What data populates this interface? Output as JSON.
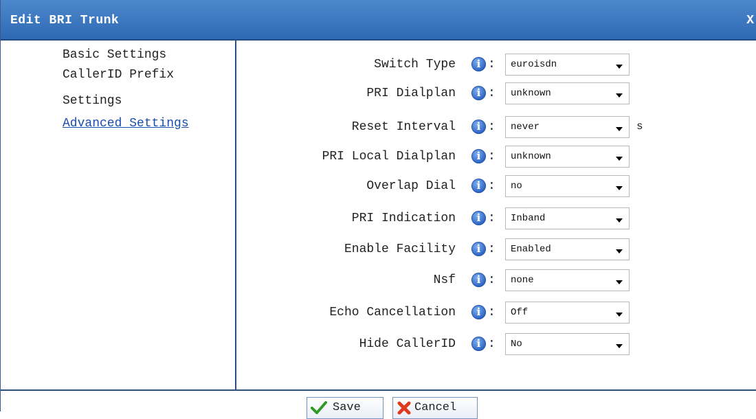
{
  "dialog": {
    "title": "Edit BRI Trunk",
    "close_label": "X"
  },
  "sidebar": {
    "items": [
      {
        "label": "Basic Settings",
        "active": false
      },
      {
        "label": "CallerID Prefix",
        "active": false
      },
      {
        "label": "Settings",
        "active": false
      },
      {
        "label": "Advanced Settings",
        "active": true
      }
    ]
  },
  "form": {
    "switch_type": {
      "label": "Switch Type",
      "value": "euroisdn"
    },
    "pri_dialplan": {
      "label": "PRI Dialplan",
      "value": "unknown"
    },
    "reset_interval": {
      "label": "Reset Interval",
      "value": "never",
      "suffix": "s"
    },
    "pri_local_dialplan": {
      "label": "PRI Local Dialplan",
      "value": "unknown"
    },
    "overlap_dial": {
      "label": "Overlap Dial",
      "value": "no"
    },
    "pri_indication": {
      "label": "PRI Indication",
      "value": "Inband"
    },
    "enable_facility": {
      "label": "Enable Facility",
      "value": "Enabled"
    },
    "nsf": {
      "label": "Nsf",
      "value": "none"
    },
    "echo_cancellation": {
      "label": "Echo Cancellation",
      "value": "Off"
    },
    "hide_callerid": {
      "label": "Hide CallerID",
      "value": "No"
    },
    "colon": ":",
    "info_glyph": "i"
  },
  "footer": {
    "save_label": "Save",
    "cancel_label": "Cancel"
  },
  "colors": {
    "title_bar": "#3d7bc4",
    "divider": "#2a4f86",
    "link": "#1a4ea8"
  },
  "icons": [
    "info-icon",
    "dropdown-arrow-icon",
    "checkmark-icon",
    "cross-icon",
    "close-icon"
  ]
}
